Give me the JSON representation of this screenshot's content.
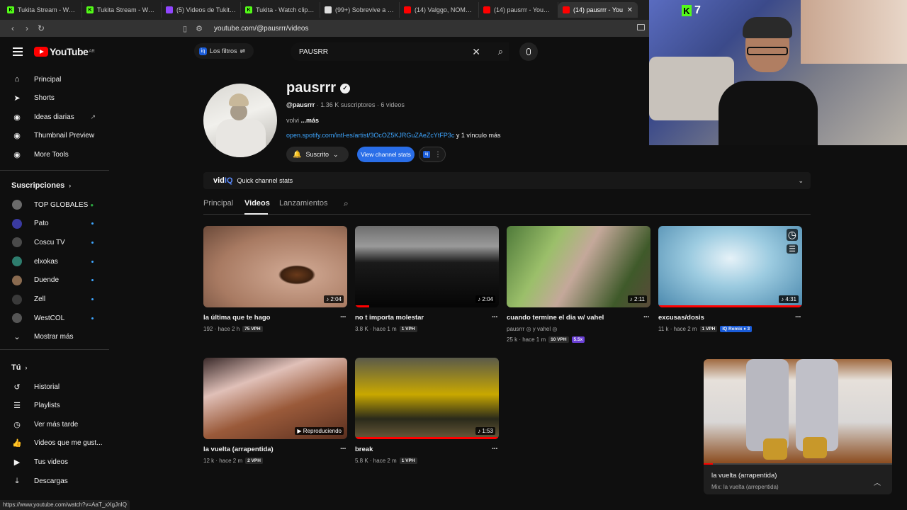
{
  "browser": {
    "tabs": [
      {
        "title": "Tukita Stream - Watch",
        "fav": "K",
        "fav_color": "#53fc18"
      },
      {
        "title": "Tukita Stream - Watch",
        "fav": "K",
        "fav_color": "#53fc18"
      },
      {
        "title": "(5) Videos de TukitaG",
        "fav": "",
        "fav_color": "#9146ff"
      },
      {
        "title": "Tukita - Watch clips o",
        "fav": "K",
        "fav_color": "#53fc18"
      },
      {
        "title": "(99+) Sobrevive a una",
        "fav": "",
        "fav_color": "#dddddd"
      },
      {
        "title": "(14) Valggo, NOMEPIE",
        "fav": "",
        "fav_color": "#ff0000"
      },
      {
        "title": "(14) pausrrr - YouTube",
        "fav": "",
        "fav_color": "#ff0000"
      },
      {
        "title": "(14) pausrrr - You",
        "fav": "",
        "fav_color": "#ff0000",
        "active": true
      }
    ],
    "close_glyph": "✕",
    "url": "youtube.com/@pausrrr/videos"
  },
  "sidebar": {
    "logo_text": "YouTube",
    "logo_country": "AR",
    "main": [
      {
        "label": "Principal",
        "icon": "home-icon",
        "glyph": "⌂"
      },
      {
        "label": "Shorts",
        "icon": "shorts-icon",
        "glyph": "➤"
      },
      {
        "label": "Ideas diarias",
        "icon": "ideas-icon",
        "glyph": "◉",
        "ext": "↗"
      },
      {
        "label": "Thumbnail Preview",
        "icon": "thumbnail-icon",
        "glyph": "◉"
      },
      {
        "label": "More Tools",
        "icon": "tools-icon",
        "glyph": "◉"
      }
    ],
    "subs_heading": "Suscripciones",
    "subs": [
      {
        "label": "TOP GLOBALES",
        "color": "#6b6b6b",
        "badge": "●"
      },
      {
        "label": "Pato",
        "color": "#3a3aa0"
      },
      {
        "label": "Coscu TV",
        "color": "#4a4a4a"
      },
      {
        "label": "elxokas",
        "color": "#2e7d6e"
      },
      {
        "label": "Duende",
        "color": "#8a6b50"
      },
      {
        "label": "Zell",
        "color": "#3a3a3a"
      },
      {
        "label": "WestCOL",
        "color": "#555555"
      }
    ],
    "show_more": "Mostrar más",
    "you_heading": "Tú",
    "you": [
      {
        "label": "Historial",
        "icon": "history-icon",
        "glyph": "↺"
      },
      {
        "label": "Playlists",
        "icon": "playlists-icon",
        "glyph": "☰"
      },
      {
        "label": "Ver más tarde",
        "icon": "watch-later-icon",
        "glyph": "◷"
      },
      {
        "label": "Videos que me gust...",
        "icon": "liked-icon",
        "glyph": "👍"
      },
      {
        "label": "Tus videos",
        "icon": "your-videos-icon",
        "glyph": "▶"
      },
      {
        "label": "Descargas",
        "icon": "downloads-icon",
        "glyph": "⤓"
      }
    ]
  },
  "topbar": {
    "filters_label": "Los filtros",
    "search_value": "PAUSRR"
  },
  "channel": {
    "name": "pausrrr",
    "handle": "@pausrrr",
    "stats": " · 1.36 K suscriptores · 6 videos",
    "desc": "volvi ",
    "desc_more": "...más",
    "link": "open.spotify.com/intl-es/artist/3OcOZ5KJRGuZAeZcYtFP3c",
    "link_more": " y 1 vínculo más",
    "subscribed_label": "Suscrito",
    "view_stats_label": "View channel stats"
  },
  "vidiq": {
    "brand": "vid",
    "brand_iq": "IQ",
    "label": "Quick channel stats"
  },
  "tabs": [
    "Principal",
    "Videos",
    "Lanzamientos"
  ],
  "videos": [
    {
      "title": "la última que te hago",
      "views": "192 · hace 2 h",
      "vph": "75 VPH",
      "duration": "♪ 2:04",
      "progress": 0
    },
    {
      "title": "no t importa molestar",
      "views": "3.8 K · hace 1 m",
      "vph": "1 VPH",
      "duration": "♪ 2:04",
      "progress": 0.1
    },
    {
      "title": "cuando termine el dia w/ vahel",
      "authors": "pausrrr ◎ y vahel ◎",
      "views": "25 k · hace 1 m",
      "vph": "10 VPH",
      "extra": "5.5x",
      "duration": "♪ 2:11",
      "progress": 0
    },
    {
      "title": "excusas/dosis",
      "views": "11 k · hace 2 m",
      "vph": "1 VPH",
      "extra": "IQ Remix ♦ 3",
      "duration": "♪ 4:31",
      "progress": 1.0
    },
    {
      "title": "la vuelta (arrapentida)",
      "views": "12 k · hace 2 m",
      "vph": "2 VPH",
      "duration": "▶ Reproduciendo",
      "progress": 0
    },
    {
      "title": "break",
      "views": "5.8 K · hace 2 m",
      "vph": "1 VPH",
      "duration": "♪ 1:53",
      "progress": 1.0
    }
  ],
  "miniplayer": {
    "title": "la vuelta (arrapentida)",
    "subtitle": "Mix: la vuelta (arrepentida)",
    "progress": 0.05
  },
  "stream": {
    "viewer_count": "7"
  },
  "status_url": "https://www.youtube.com/watch?v=AaT_xXgJnIQ"
}
